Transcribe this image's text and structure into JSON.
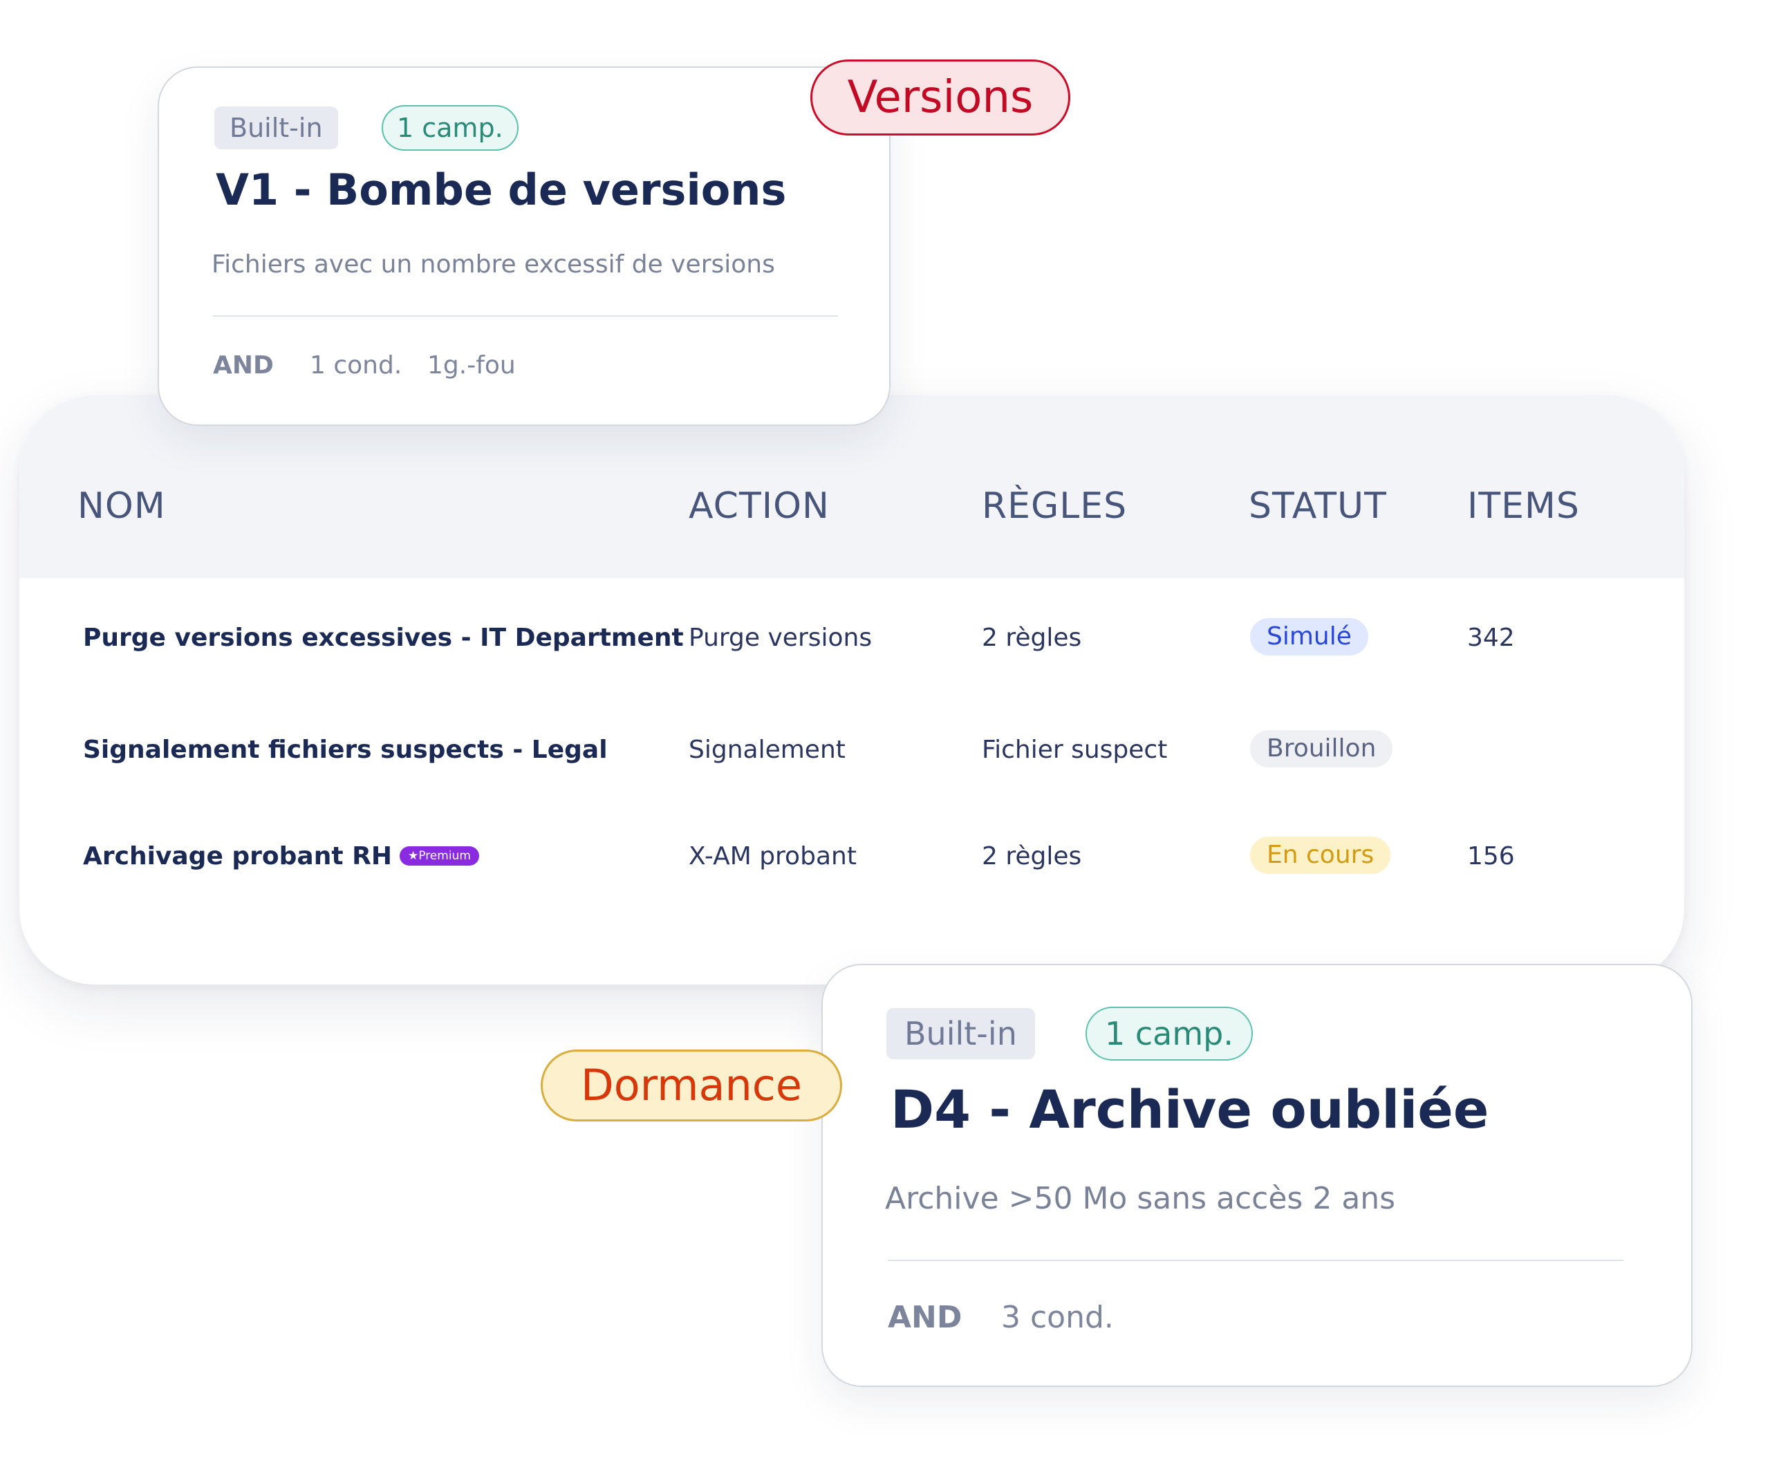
{
  "table": {
    "headers": {
      "nom": "NOM",
      "action": "ACTION",
      "regles": "RÈGLES",
      "statut": "STATUT",
      "items": "ITEMS"
    },
    "rows": [
      {
        "name": "Purge versions excessives - IT Department",
        "action": "Purge versions",
        "rules": "2 règles",
        "status": "Simulé",
        "items": "342"
      },
      {
        "name": "Signalement fichiers suspects - Legal",
        "action": "Signalement",
        "rules": "Fichier suspect",
        "status": "Brouillon",
        "items": ""
      },
      {
        "name": "Archivage probant RH",
        "premium_badge": "★Premium",
        "action": "X-AM probant",
        "rules": "2 règles",
        "status": "En cours",
        "items": "156"
      }
    ],
    "status_colors": {
      "simule": "#2946d8",
      "brouillon": "#5a6482",
      "en_cours": "#d49a10"
    }
  },
  "rule_cards": [
    {
      "category": "Versions",
      "category_color": "#c20a24",
      "builtin_tag": "Built-in",
      "campaign_tag": "1 camp.",
      "title": "V1 - Bombe de versions",
      "description": "Fichiers avec un nombre excessif de versions",
      "operator": "AND",
      "conditions": "1 cond.",
      "extra": "1g.-fou"
    },
    {
      "category": "Dormance",
      "category_color": "#d6380a",
      "builtin_tag": "Built-in",
      "campaign_tag": "1 camp.",
      "title": "D4 - Archive oubliée",
      "description": "Archive >50 Mo sans accès 2 ans",
      "operator": "AND",
      "conditions": "3 cond."
    }
  ]
}
